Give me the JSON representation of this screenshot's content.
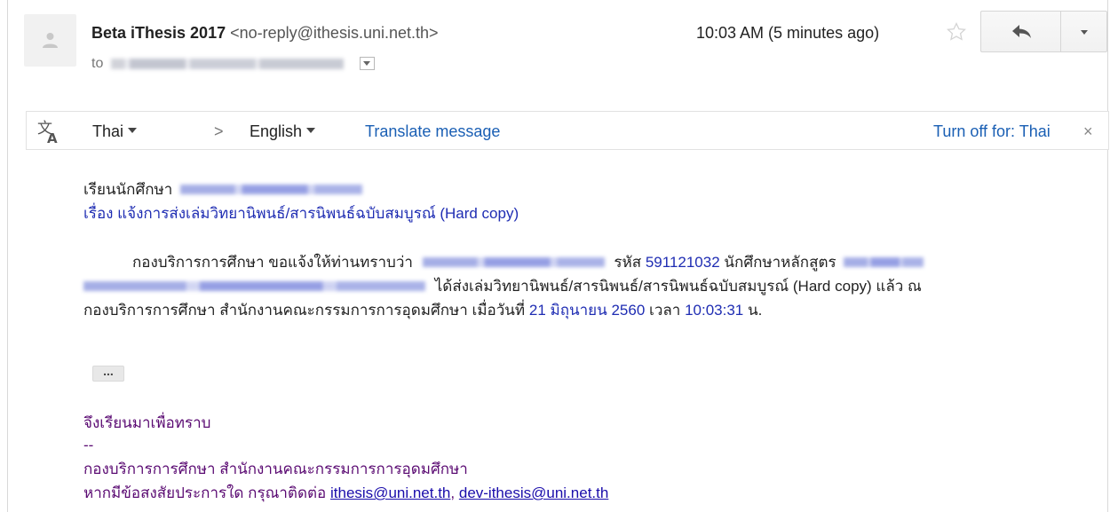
{
  "header": {
    "sender_name": "Beta iThesis 2017",
    "sender_email": "<no-reply@ithesis.uni.net.th>",
    "to_prefix": "to",
    "timestamp": "10:03 AM (5 minutes ago)",
    "avatar_icon": "person-icon",
    "star_icon": "star-outline-icon",
    "reply_icon": "reply-arrow-icon",
    "more_icon": "chevron-down-icon"
  },
  "translate_bar": {
    "icon": "translate-icon",
    "from_language": "Thai",
    "arrow": ">",
    "to_language": "English",
    "translate_link": "Translate message",
    "turn_off_link": "Turn off for: Thai",
    "close": "×"
  },
  "message": {
    "greeting": "เรียนนักศึกษา",
    "subject": "เรื่อง แจ้งการส่งเล่มวิทยานิพนธ์/สารนิพนธ์ฉบับสมบูรณ์ (Hard copy)",
    "para_line1_a": "กองบริการการศึกษา ขอแจ้งให้ท่านทราบว่า",
    "para_line1_b": "รหัส",
    "student_id": "591121032",
    "para_line1_c": "นักศึกษาหลักสูตร",
    "para_line2": "ได้ส่งเล่มวิทยานิพนธ์/สารนิพนธ์/สารนิพนธ์ฉบับสมบูรณ์ (Hard copy) แล้ว ณ",
    "para_line3_a": "กองบริการการศึกษา สำนักงานคณะกรรมการการอุดมศึกษา เมื่อวันที่",
    "date": "21 มิถุนายน 2560",
    "para_line3_b": "เวลา",
    "time": "10:03:31",
    "para_line3_c": "น.",
    "ellipsis": "...",
    "closing": "จึงเรียนมาเพื่อทราบ",
    "separator": "--",
    "signature": "กองบริการการศึกษา สำนักงานคณะกรรมการการอุดมศึกษา",
    "contact_prefix": "หากมีข้อสงสัยประการใด กรุณาติดต่อ",
    "contact_email_1": "ithesis@uni.net.th",
    "contact_sep": ",",
    "contact_email_2": "dev-ithesis@uni.net.th"
  },
  "colors": {
    "link_blue": "#1a5fb4",
    "body_blue": "#1f2db3",
    "body_purple": "#5a0a72"
  }
}
